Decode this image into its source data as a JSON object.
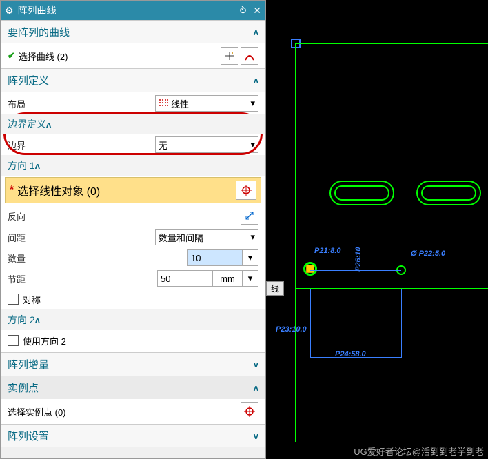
{
  "title": "阵列曲线",
  "sections": {
    "curves": {
      "header": "要阵列的曲线",
      "select_label": "选择曲线 (2)"
    },
    "definition": {
      "header": "阵列定义",
      "layout_label": "布局",
      "layout_value": "线性",
      "boundary_header": "边界定义",
      "boundary_label": "边界",
      "boundary_value": "无",
      "dir1": {
        "header": "方向 1",
        "select_label": "选择线性对象 (0)",
        "reverse_label": "反向",
        "spacing_label": "间距",
        "spacing_value": "数量和间隔",
        "count_label": "数量",
        "count_value": "10",
        "pitch_label": "节距",
        "pitch_value": "50",
        "pitch_unit": "mm",
        "sym_label": "对称"
      },
      "dir2": {
        "header": "方向 2",
        "use_label": "使用方向 2"
      }
    },
    "increment": {
      "header": "阵列增量"
    },
    "instance": {
      "header": "实例点",
      "select_label": "选择实例点 (0)"
    },
    "settings": {
      "header": "阵列设置"
    }
  },
  "canvas": {
    "tag": "线",
    "dims": {
      "p21": "P21:8.0",
      "p22": "Ø P22:5.0",
      "p23": "P23:10.0",
      "p24": "P24:58.0",
      "p26": "P26:10"
    },
    "watermark": "UG爱好者论坛@活到到老学到老"
  }
}
